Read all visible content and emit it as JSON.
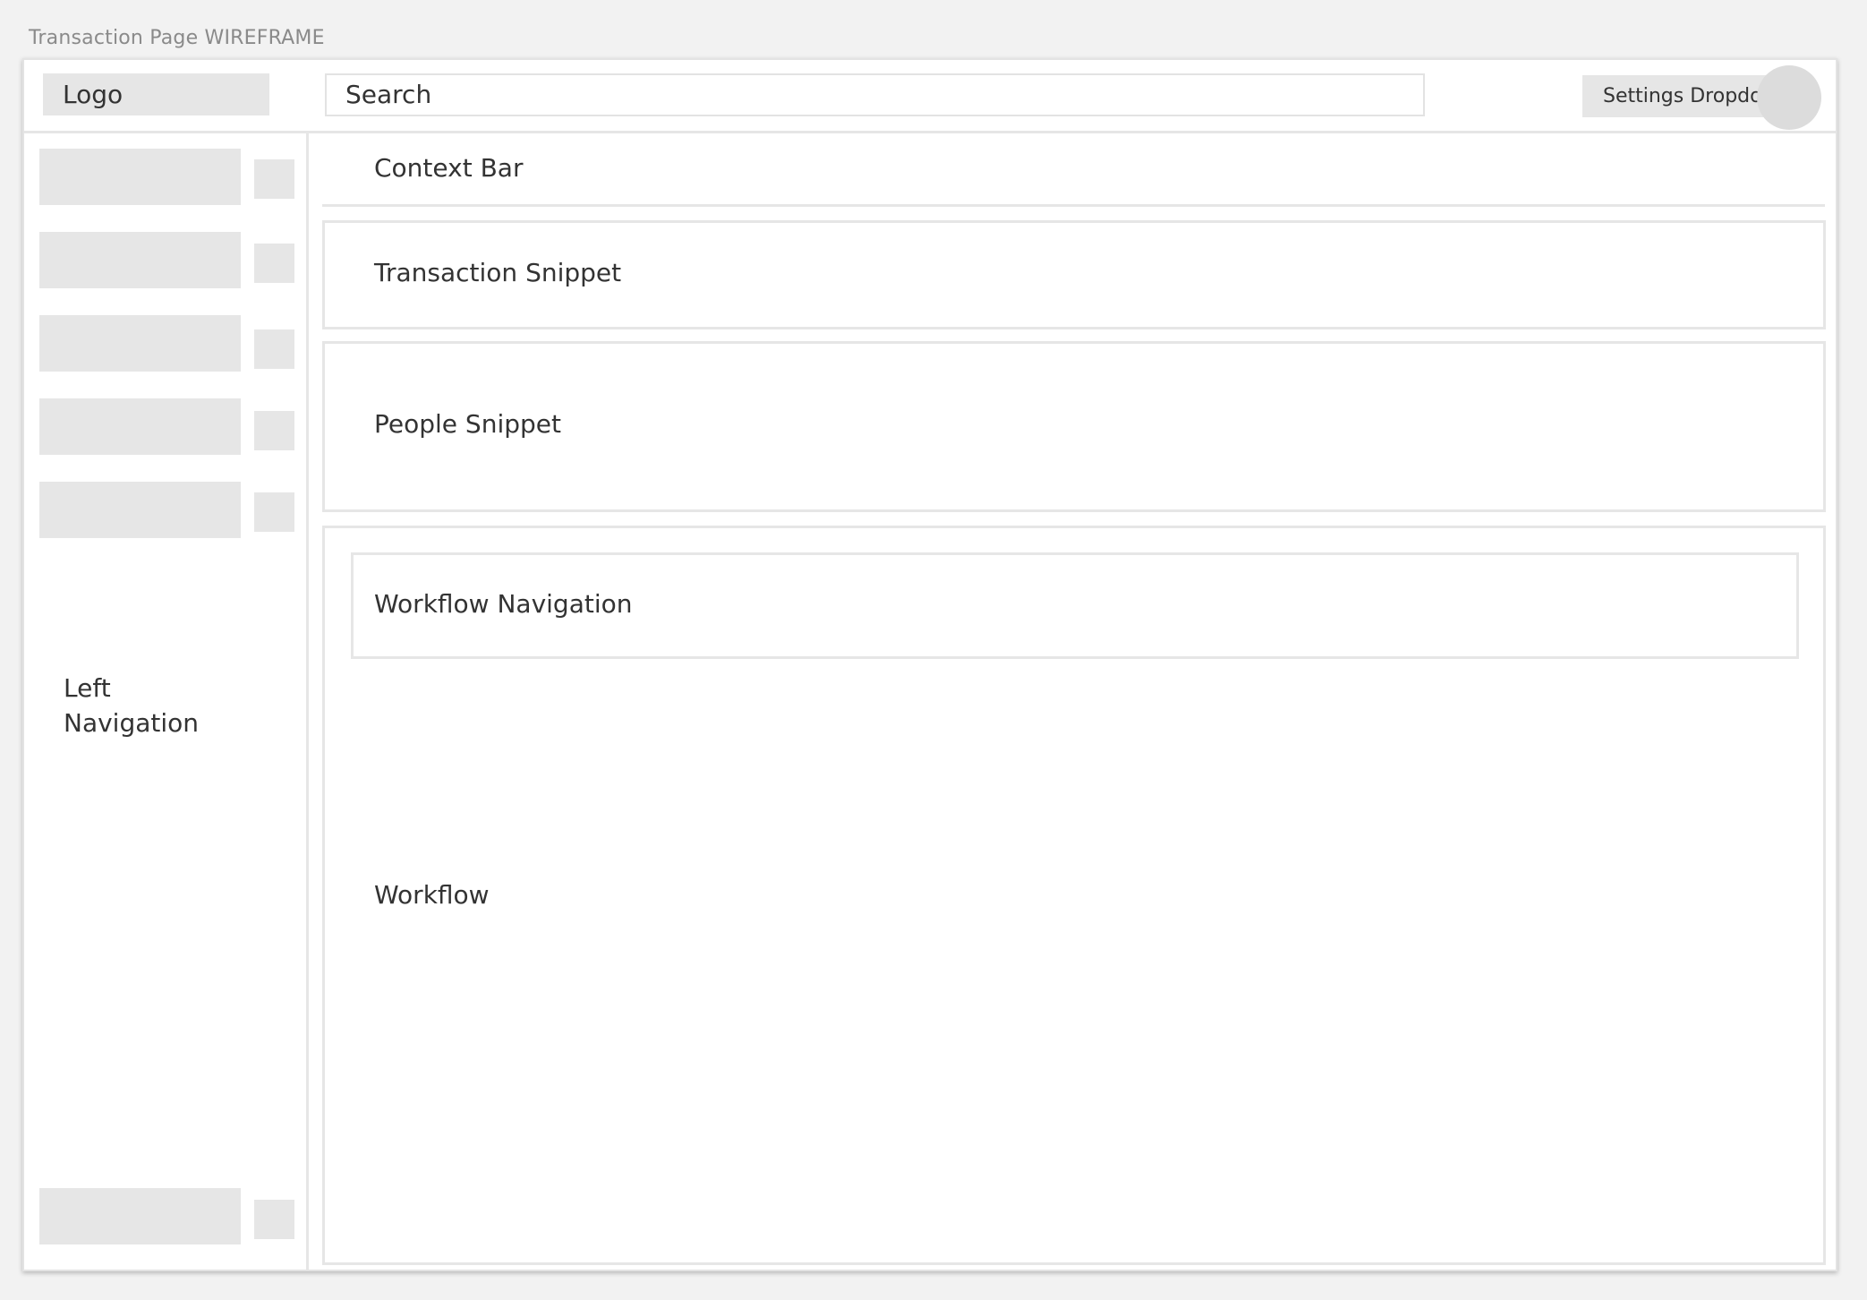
{
  "canvas": {
    "title": "Transaction Page WIREFRAME"
  },
  "header": {
    "logo": "Logo",
    "search_placeholder": "Search",
    "settings": "Settings Dropdown"
  },
  "sidebar": {
    "label": "Left Navigation",
    "item_count": 6
  },
  "main": {
    "context_bar": "Context Bar",
    "transaction_snippet": "Transaction Snippet",
    "people_snippet": "People Snippet",
    "workflow_navigation": "Workflow Navigation",
    "workflow": "Workflow"
  },
  "colors": {
    "canvas_bg": "#f2f2f2",
    "placeholder_fill": "#e6e6e6",
    "border": "#e6e6e6",
    "avatar": "#dcdcdc",
    "text": "#333333"
  }
}
